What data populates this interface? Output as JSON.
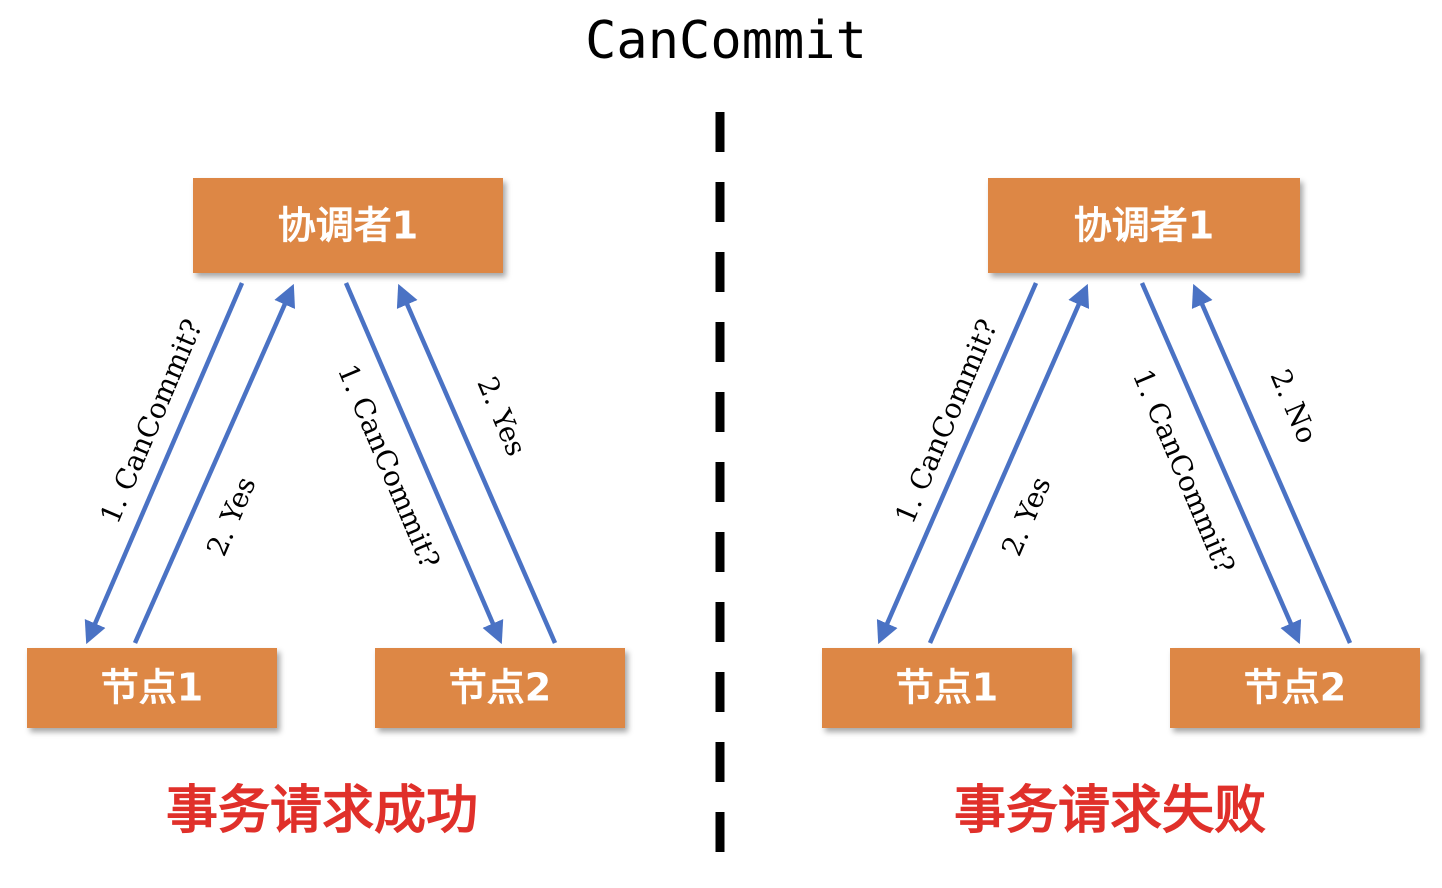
{
  "title": "CanCommit",
  "colors": {
    "box_fill": "#dd8744",
    "box_text": "#ffffff",
    "arrow": "#4a72c4",
    "caption": "#e0302a",
    "divider": "#000000"
  },
  "panels": [
    {
      "coordinator": "协调者1",
      "node1": "节点1",
      "node2": "节点2",
      "labels": {
        "to_node1": "1. CanCommit?",
        "from_node1": "2. Yes",
        "to_node2": "1. CanCommit?",
        "from_node2": "2. Yes"
      },
      "caption": "事务请求成功"
    },
    {
      "coordinator": "协调者1",
      "node1": "节点1",
      "node2": "节点2",
      "labels": {
        "to_node1": "1. CanCommit?",
        "from_node1": "2. Yes",
        "to_node2": "1. CanCommit?",
        "from_node2": "2. No"
      },
      "caption": "事务请求失败"
    }
  ]
}
